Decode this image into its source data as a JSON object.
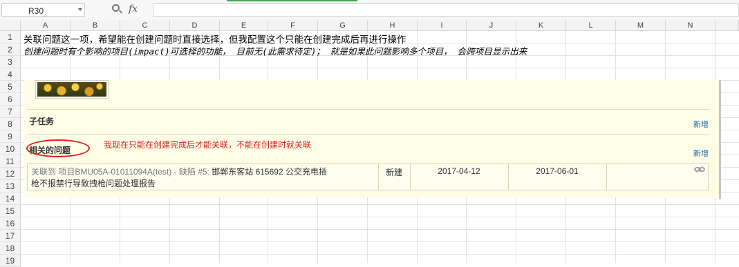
{
  "formula_bar": {
    "cell_ref": "R30",
    "fx_label": "fx",
    "formula_value": ""
  },
  "columns": [
    "A",
    "B",
    "C",
    "D",
    "E",
    "F",
    "G",
    "H",
    "I",
    "J",
    "K",
    "L",
    "M",
    "N"
  ],
  "rows": [
    "1",
    "2",
    "3",
    "4",
    "5",
    "6",
    "7",
    "8",
    "9",
    "10",
    "11",
    "12",
    "13",
    "14",
    "15",
    "16",
    "17",
    "18",
    "19"
  ],
  "cells": {
    "a1": "关联问题这一项，希望能在创建问题时直接选择，但我配置这个只能在创建完成后再进行操作",
    "a2": "创建问题时有个影响的项目(impact)可选择的功能， 目前无(此需求待定)； 就是如果此问题影响多个项目， 会跨项目显示出来"
  },
  "embedded": {
    "subtask_title": "子任务",
    "subtask_new": "新增",
    "related_title": "相关的问题",
    "related_new": "新增",
    "annotation": "我现在只能在创建完成后才能关联，不能在创建时就关联",
    "issue": {
      "prefix": "关联到 项目BMU05A-01011094A(test) -",
      "type": "缺陷 #5:",
      "title_line1": "邯郸东客站 615692 公交充电插",
      "title_line2": "枪不报禁行导致拽枪问题处理报告",
      "status": "新建",
      "start_date": "2017-04-12",
      "due_date": "2017-06-01"
    }
  },
  "colors": {
    "accent_green": "#3fa654",
    "annotation_red": "#d61d1d",
    "link_blue": "#1b5faa",
    "panel_bg": "#fefee6"
  }
}
